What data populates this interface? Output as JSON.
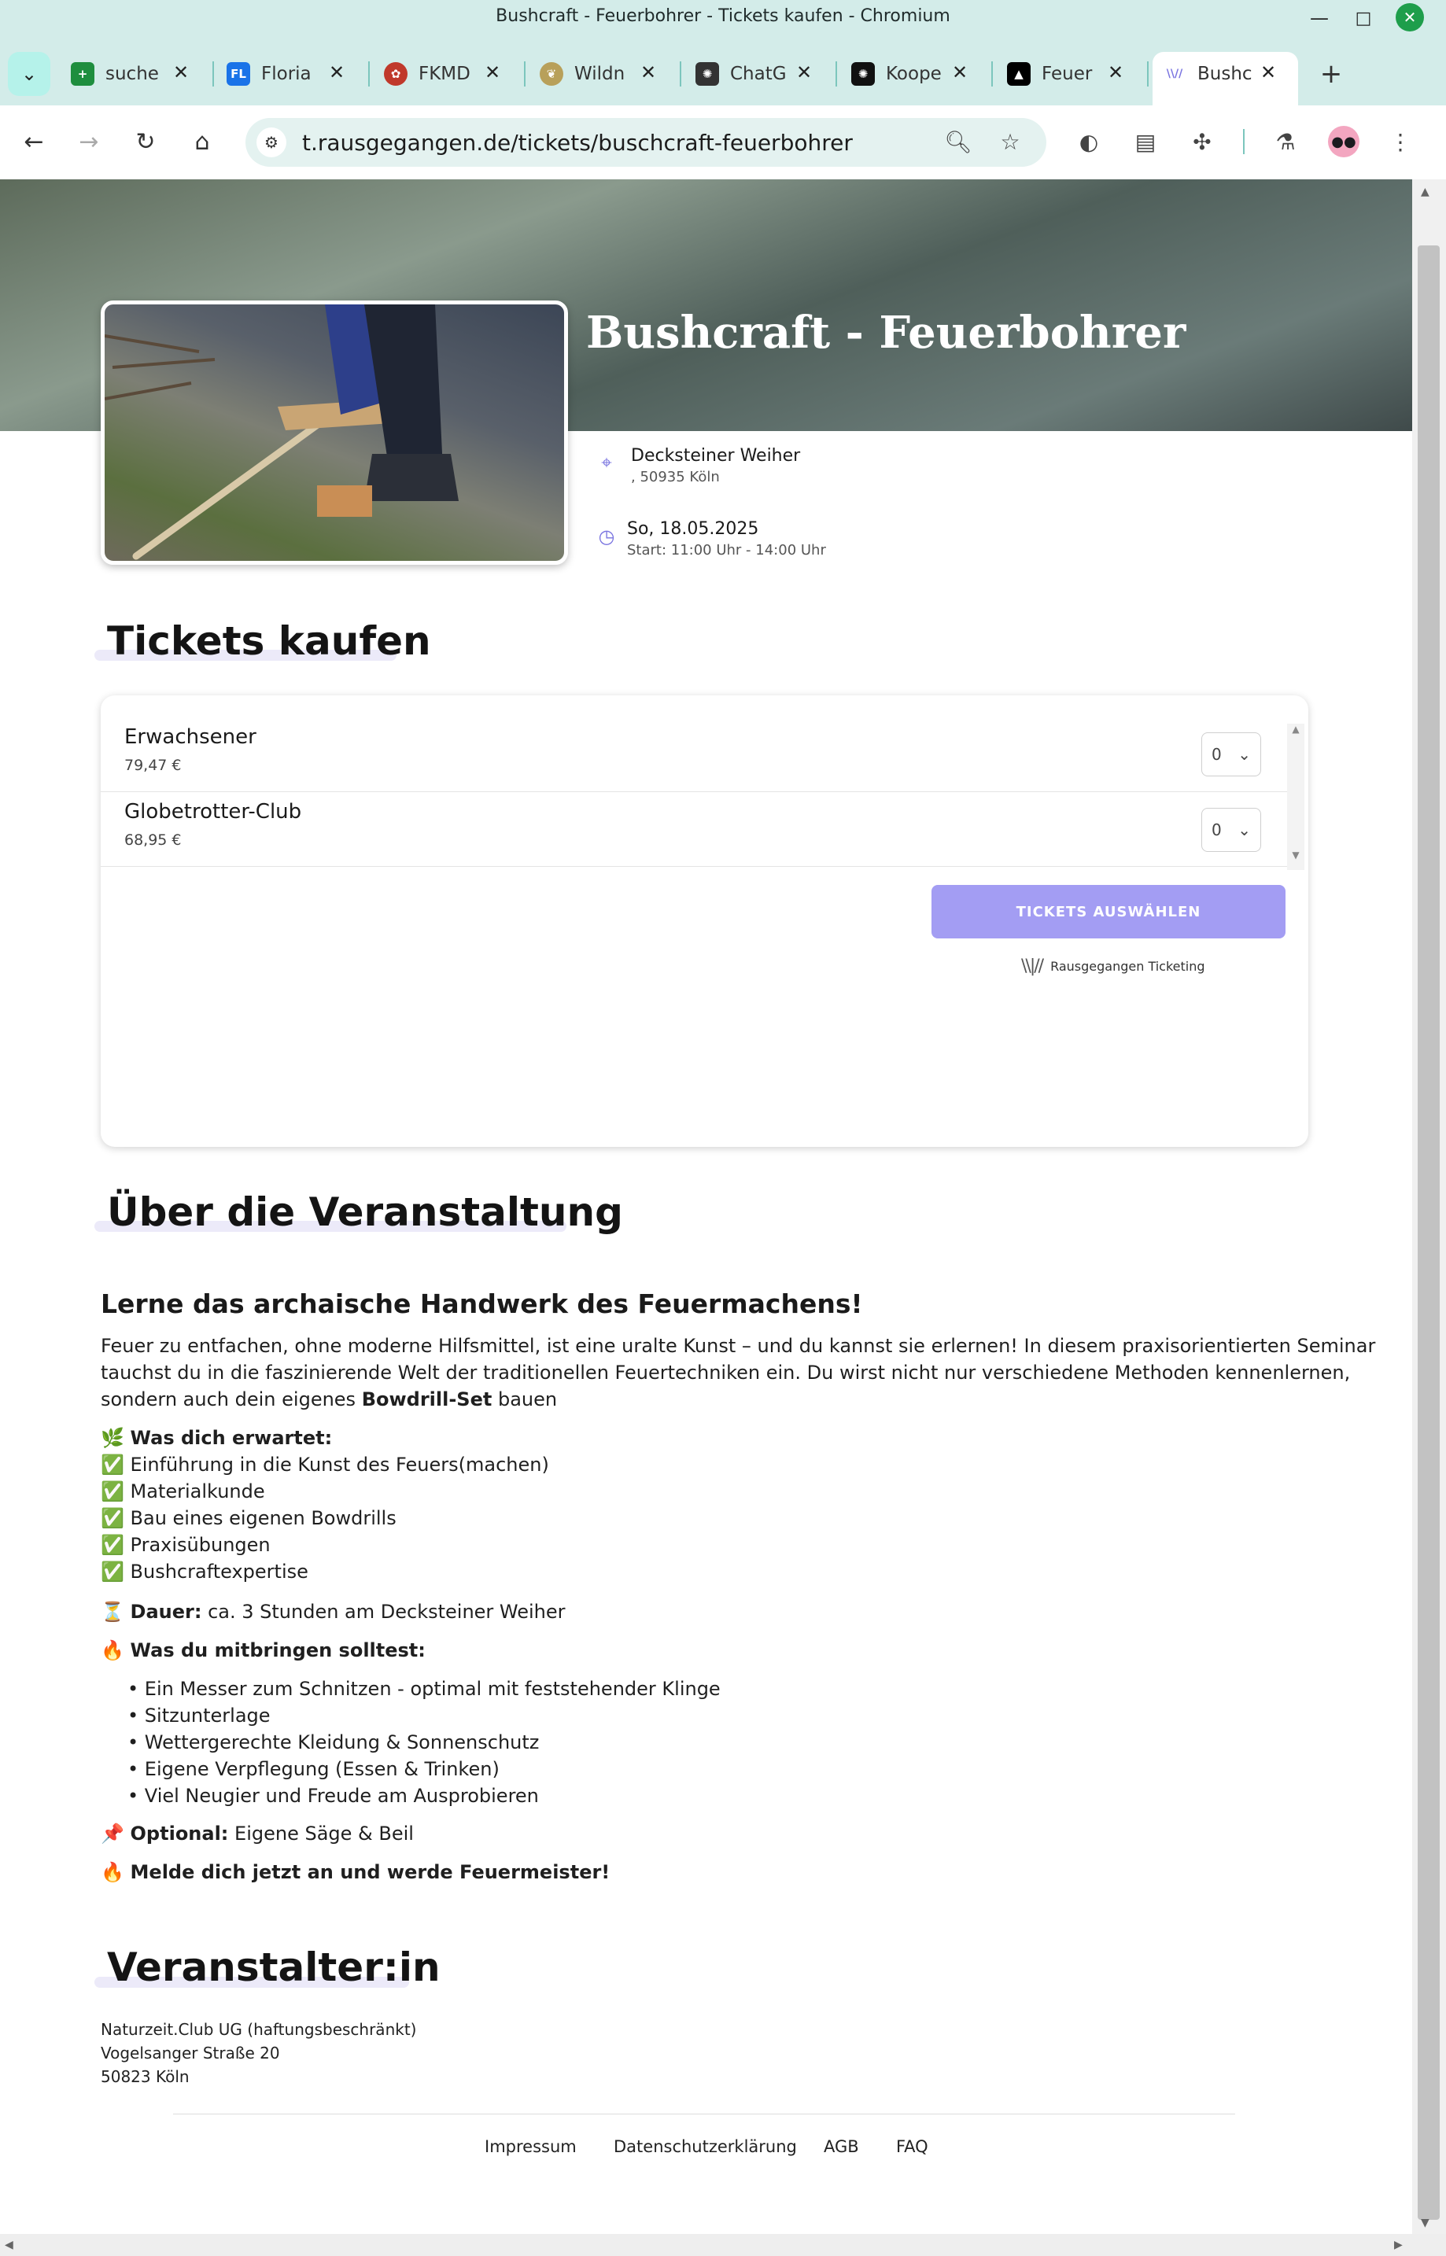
{
  "window": {
    "title": "Bushcraft - Feuerbohrer - Tickets kaufen - Chromium",
    "minimize": "—",
    "maximize": "□",
    "close": "✕"
  },
  "tabs": [
    {
      "label": "suche",
      "icon": "sheets-icon",
      "color": "#1e8e3e",
      "glyph": "+"
    },
    {
      "label": "Floria",
      "icon": "fl-icon",
      "color": "#1a73e8",
      "glyph": "FL"
    },
    {
      "label": "FKMD",
      "icon": "tree-icon",
      "color": "#c0392b",
      "glyph": "✿"
    },
    {
      "label": "Wildn",
      "icon": "wildnis-icon",
      "color": "#b8a05a",
      "glyph": "❦"
    },
    {
      "label": "ChatG",
      "icon": "openai-icon",
      "color": "#333333",
      "glyph": "✺"
    },
    {
      "label": "Koope",
      "icon": "openai-dark-icon",
      "color": "#111111",
      "glyph": "✺"
    },
    {
      "label": "Feuer",
      "icon": "feuer-icon",
      "color": "#000000",
      "glyph": "▲"
    },
    {
      "label": "Bushc",
      "icon": "rausgegangen-icon",
      "color": "#7a74e0",
      "glyph": "\\\\//"
    }
  ],
  "new_tab": "+",
  "toolbar": {
    "url": "t.rausgegangen.de/tickets/buschcraft-feuerbohrer"
  },
  "event": {
    "title": "Bushcraft - Feuerbohrer",
    "location_name": "Decksteiner Weiher",
    "location_address": ", 50935 Köln",
    "date": "So, 18.05.2025",
    "time": "Start: 11:00 Uhr - 14:00 Uhr"
  },
  "tickets": {
    "heading": "Tickets kaufen",
    "items": [
      {
        "name": "Erwachsener",
        "price": "79,47 €",
        "qty": "0"
      },
      {
        "name": "Globetrotter-Club",
        "price": "68,95 €",
        "qty": "0"
      }
    ],
    "button": "TICKETS AUSWÄHLEN",
    "brand": "Rausgegangen Ticketing"
  },
  "about": {
    "heading": "Über die Veranstaltung",
    "subheading": "Lerne das archaische Handwerk des Feuermachens!",
    "intro_1": "Feuer zu entfachen, ohne moderne Hilfsmittel, ist eine uralte Kunst – und du kannst sie erlernen! In diesem praxisorientierten Seminar",
    "intro_2": "tauchst du in die faszinierende Welt der traditionellen Feuertechniken ein. Du wirst nicht nur verschiedene Methoden kennenlernen,",
    "intro_3a": "sondern auch dein eigenes ",
    "intro_3b": "Bowdrill-Set",
    "intro_3c": " bauen",
    "expect_emoji": "🌿",
    "expect_label": "Was dich erwartet:",
    "check": "✅",
    "expect_items": [
      "Einführung in die Kunst des Feuers(machen)",
      "Materialkunde",
      "Bau eines eigenen Bowdrills",
      "Praxisübungen",
      "Bushcraftexpertise"
    ],
    "duration_emoji": "⏳",
    "duration_label": "Dauer:",
    "duration_text": " ca. 3 Stunden am Decksteiner Weiher",
    "bring_emoji": "🔥",
    "bring_label": "Was du mitbringen solltest:",
    "bring_items": [
      "Ein Messer zum Schnitzen - optimal mit feststehender Klinge",
      "Sitzunterlage",
      "Wettergerechte Kleidung & Sonnenschutz",
      "Eigene Verpflegung (Essen & Trinken)",
      "Viel Neugier und Freude am Ausprobieren"
    ],
    "optional_emoji": "📌",
    "optional_label": "Optional:",
    "optional_text": " Eigene Säge & Beil",
    "cta_emoji": "🔥",
    "cta_text": "Melde dich jetzt an und werde Feuermeister!"
  },
  "organizer": {
    "heading": "Veranstalter:in",
    "line1": "Naturzeit.Club UG (haftungsbeschränkt)",
    "line2": "Vogelsanger Straße 20",
    "line3": "50823 Köln"
  },
  "footer": {
    "links": [
      "Impressum",
      "Datenschutzerklärung",
      "AGB",
      "FAQ"
    ]
  },
  "colors": {
    "accent": "#a39df3",
    "chrome": "#d3ece9"
  }
}
